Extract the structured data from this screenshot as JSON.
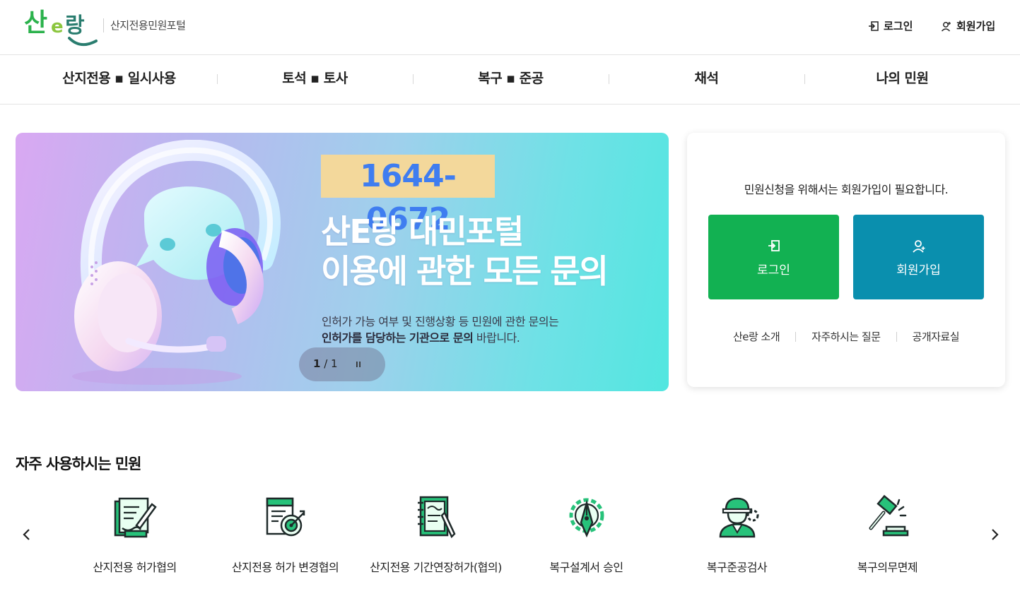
{
  "header": {
    "logo_text": "산e랑",
    "logo_sub": "산지전용민원포털",
    "login_label": "로그인",
    "join_label": "회원가입"
  },
  "gnb": {
    "items": [
      {
        "label": "산지전용 ▪ 일시사용"
      },
      {
        "label": "토석 ▪ 토사"
      },
      {
        "label": "복구 ▪ 준공"
      },
      {
        "label": "채석"
      },
      {
        "label": "나의 민원"
      }
    ]
  },
  "banner": {
    "phone": "1644-0672",
    "title": "산E랑 대민포털\n이용에 관한 모든 문의",
    "desc_line1": "인허가 가능 여부 및 진행상황 등 민원에 관한 문의는",
    "desc_line2_bold": "인허가를 담당하는 기관으로 문의",
    "desc_line2_rest": " 바랍니다.",
    "pager_current": "1",
    "pager_sep": " / ",
    "pager_total": "1"
  },
  "login_card": {
    "message": "민원신청을 위해서는 회원가입이 필요합니다.",
    "login_button": "로그인",
    "join_button": "회원가입",
    "links": [
      "산e랑 소개",
      "자주하시는 질문",
      "공개자료실"
    ]
  },
  "frequent": {
    "title": "자주 사용하시는 민원",
    "items": [
      {
        "label": "산지전용 허가협의",
        "icon": "document-sign-icon"
      },
      {
        "label": "산지전용 허가 변경협의",
        "icon": "document-target-icon"
      },
      {
        "label": "산지전용 기간연장허가(협의)",
        "icon": "notebook-pen-icon"
      },
      {
        "label": "복구설계서 승인",
        "icon": "design-gear-icon"
      },
      {
        "label": "복구준공검사",
        "icon": "engineer-icon"
      },
      {
        "label": "복구의무면제",
        "icon": "gavel-icon"
      }
    ]
  },
  "colors": {
    "green": "#12b152",
    "teal": "#0a8fae",
    "phone_bg": "#f3d89b",
    "phone_text": "#3f7df0"
  }
}
